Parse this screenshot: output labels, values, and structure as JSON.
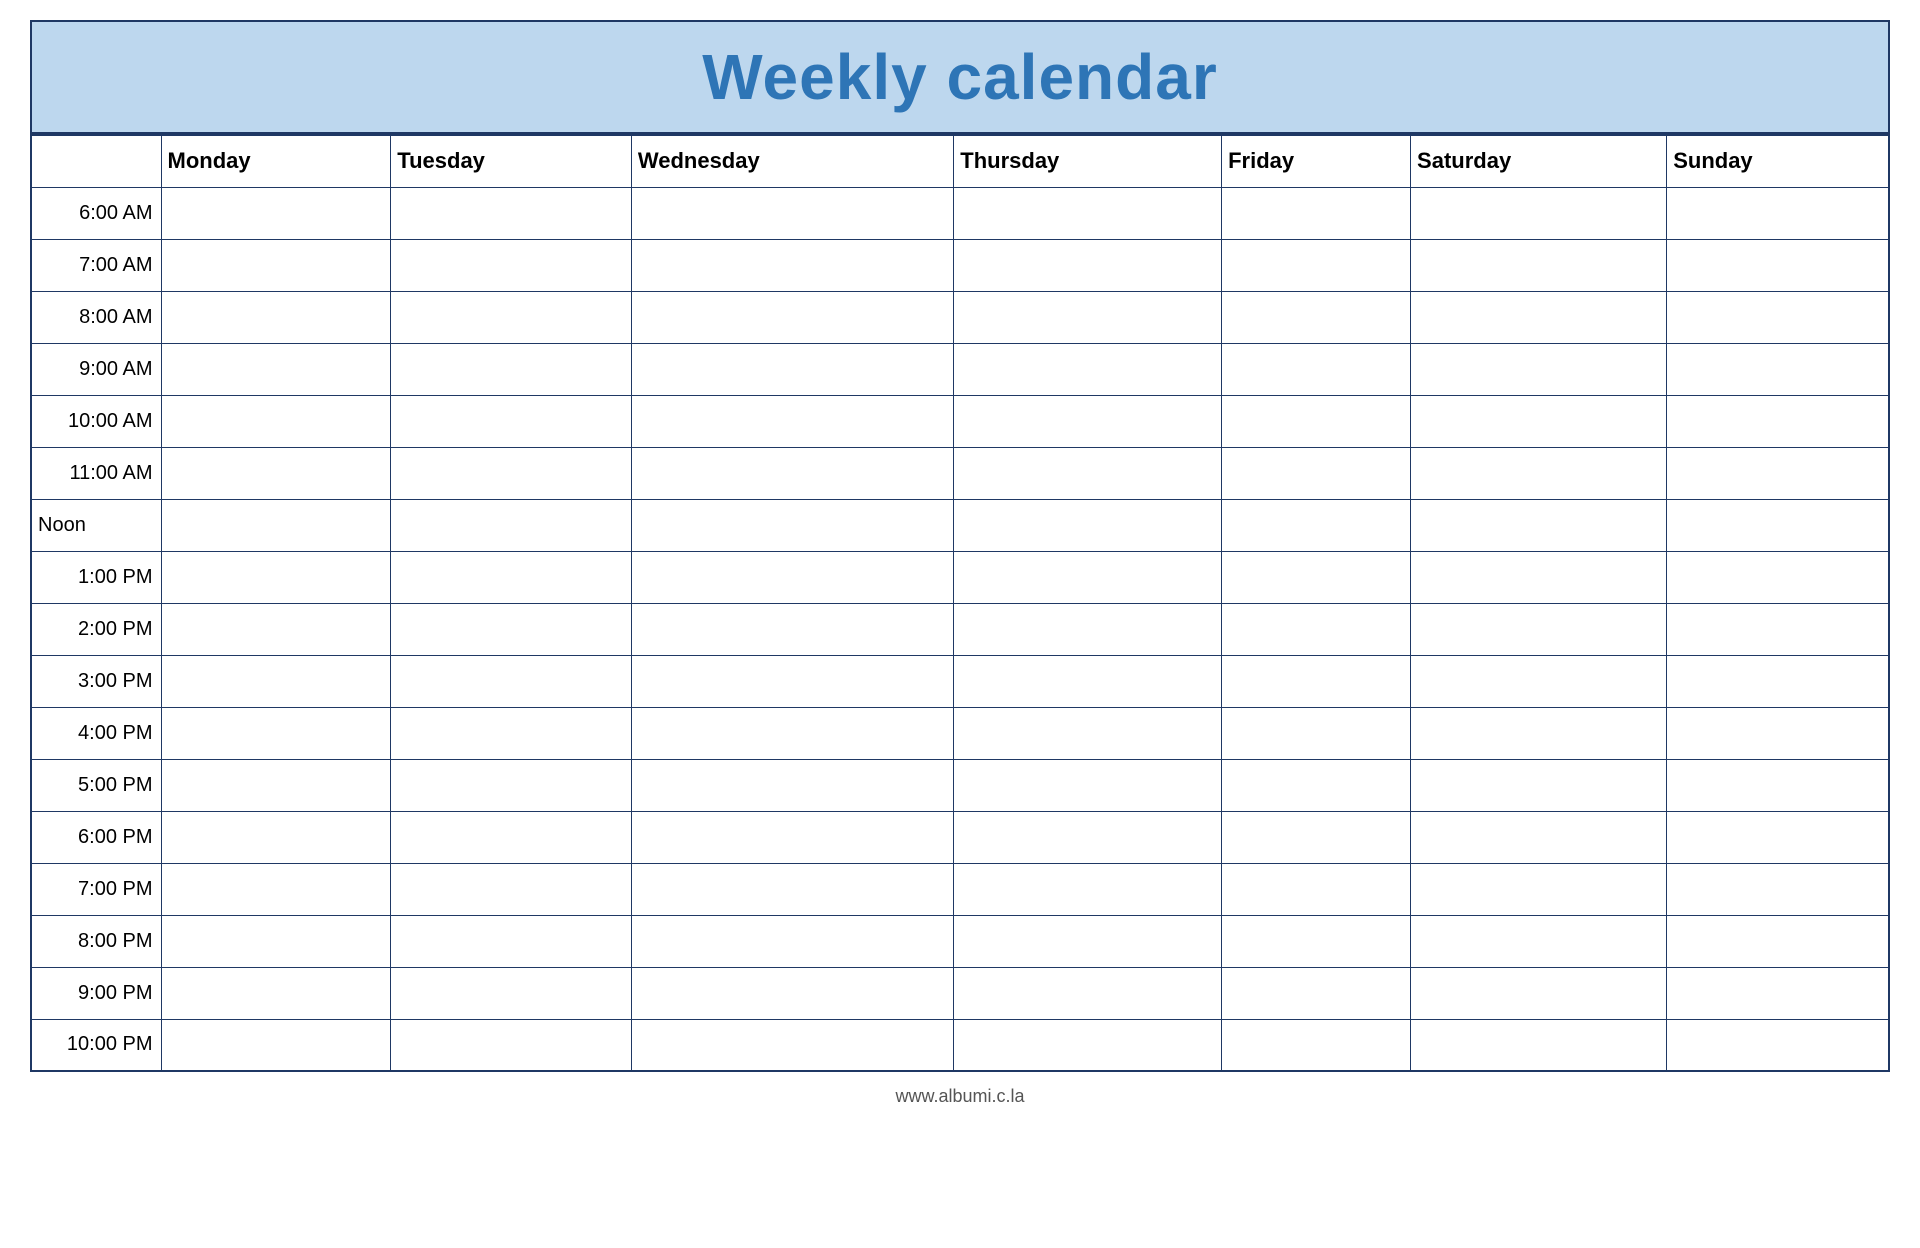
{
  "header": {
    "title": "Weekly calendar",
    "background_color": "#bdd7ee",
    "title_color": "#2e75b6"
  },
  "columns": {
    "time_label": "",
    "days": [
      "Monday",
      "Tuesday",
      "Wednesday",
      "Thursday",
      "Friday",
      "Saturday",
      "Sunday"
    ]
  },
  "time_slots": [
    {
      "label": "6:00 AM",
      "is_noon": false
    },
    {
      "label": "7:00 AM",
      "is_noon": false
    },
    {
      "label": "8:00 AM",
      "is_noon": false
    },
    {
      "label": "9:00 AM",
      "is_noon": false
    },
    {
      "label": "10:00 AM",
      "is_noon": false
    },
    {
      "label": "11:00 AM",
      "is_noon": false
    },
    {
      "label": "Noon",
      "is_noon": true
    },
    {
      "label": "1:00 PM",
      "is_noon": false
    },
    {
      "label": "2:00 PM",
      "is_noon": false
    },
    {
      "label": "3:00 PM",
      "is_noon": false
    },
    {
      "label": "4:00 PM",
      "is_noon": false
    },
    {
      "label": "5:00 PM",
      "is_noon": false
    },
    {
      "label": "6:00 PM",
      "is_noon": false
    },
    {
      "label": "7:00 PM",
      "is_noon": false
    },
    {
      "label": "8:00 PM",
      "is_noon": false
    },
    {
      "label": "9:00 PM",
      "is_noon": false
    },
    {
      "label": "10:00 PM",
      "is_noon": false
    }
  ],
  "footer": {
    "url": "www.albumi.c.la"
  }
}
